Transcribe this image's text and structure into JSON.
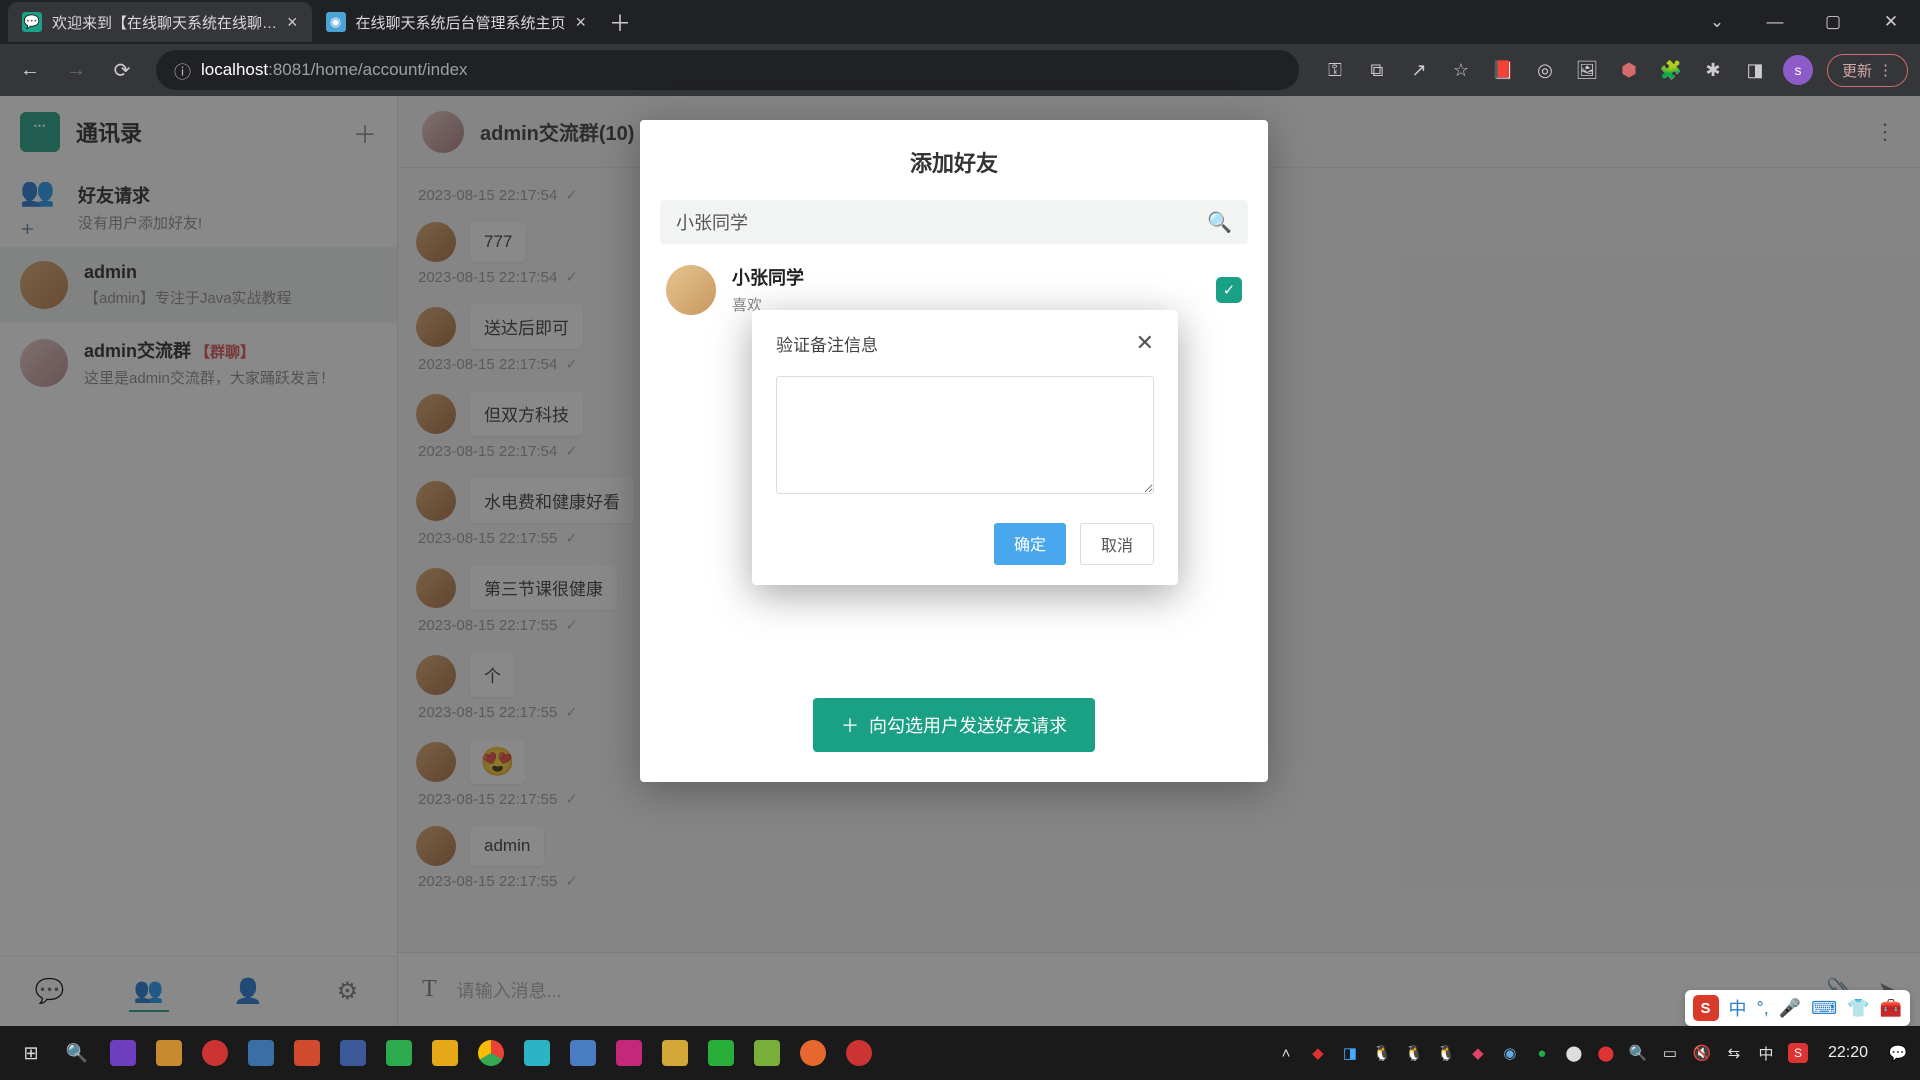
{
  "browser": {
    "tabs": [
      {
        "title": "欢迎来到【在线聊天系统在线聊…",
        "favicon_label": "chat"
      },
      {
        "title": "在线聊天系统后台管理系统主页",
        "favicon_label": "admin"
      }
    ],
    "url_prefix": "localhost",
    "url_port": ":8081",
    "url_path": "/home/account/index",
    "update_label": "更新"
  },
  "sidebar": {
    "title": "通讯录",
    "friend_request": {
      "title": "好友请求",
      "subtitle": "没有用户添加好友!"
    },
    "items": [
      {
        "name": "admin",
        "subtitle": "【admin】专注于Java实战教程"
      },
      {
        "name": "admin交流群",
        "tag": "【群聊】",
        "subtitle": "这里是admin交流群，大家踊跃发言！"
      }
    ]
  },
  "chat": {
    "header": "admin交流群(10)",
    "input_placeholder": "请输入消息...",
    "messages": [
      {
        "text": "",
        "time": "2023-08-15 22:17:54"
      },
      {
        "text": "777",
        "time": "2023-08-15 22:17:54"
      },
      {
        "text": "送达后即可",
        "time": "2023-08-15 22:17:54"
      },
      {
        "text": "但双方科技",
        "time": "2023-08-15 22:17:54"
      },
      {
        "text": "水电费和健康好看",
        "time": "2023-08-15 22:17:55"
      },
      {
        "text": "第三节课很健康",
        "time": "2023-08-15 22:17:55"
      },
      {
        "text": "个",
        "time": "2023-08-15 22:17:55"
      },
      {
        "text": "😍",
        "time": "2023-08-15 22:17:55",
        "emoji": true
      },
      {
        "text": "admin",
        "time": "2023-08-15 22:17:55"
      }
    ]
  },
  "add_modal": {
    "title": "添加好友",
    "search_value": "小张同学",
    "result": {
      "name": "小张同学",
      "subtitle": "喜欢"
    },
    "send_label": "向勾选用户发送好友请求"
  },
  "verify_modal": {
    "title": "验证备注信息",
    "textarea_value": "",
    "ok_label": "确定",
    "cancel_label": "取消"
  },
  "ime": {
    "logo": "S",
    "lang": "中"
  },
  "taskbar": {
    "clock": "22:20",
    "tray_lang": "中"
  }
}
